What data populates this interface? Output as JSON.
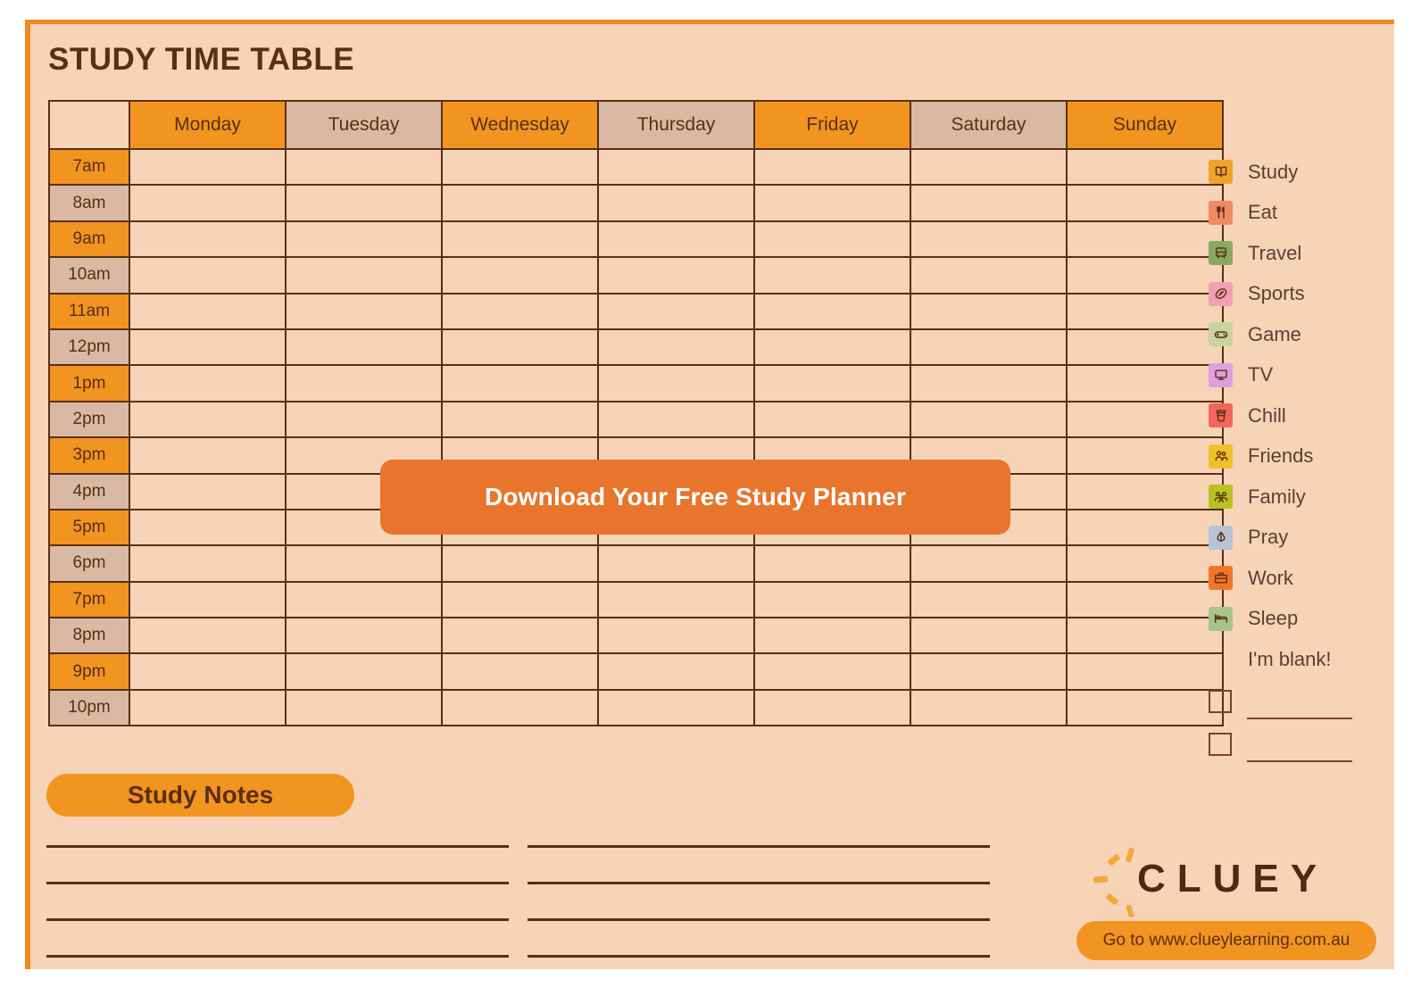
{
  "page": {
    "title": "STUDY TIME TABLE",
    "background_color": "#f7d3b7",
    "border_color": "#ef8a21",
    "text_color": "#5a2f12"
  },
  "timetable": {
    "corner_label": "",
    "days": [
      {
        "label": "Monday",
        "tint": "orange"
      },
      {
        "label": "Tuesday",
        "tint": "tan"
      },
      {
        "label": "Wednesday",
        "tint": "orange"
      },
      {
        "label": "Thursday",
        "tint": "tan"
      },
      {
        "label": "Friday",
        "tint": "orange"
      },
      {
        "label": "Saturday",
        "tint": "tan"
      },
      {
        "label": "Sunday",
        "tint": "orange"
      }
    ],
    "times": [
      {
        "label": "7am",
        "tint": "orange"
      },
      {
        "label": "8am",
        "tint": "tan"
      },
      {
        "label": "9am",
        "tint": "orange"
      },
      {
        "label": "10am",
        "tint": "tan"
      },
      {
        "label": "11am",
        "tint": "orange"
      },
      {
        "label": "12pm",
        "tint": "tan"
      },
      {
        "label": "1pm",
        "tint": "orange"
      },
      {
        "label": "2pm",
        "tint": "tan"
      },
      {
        "label": "3pm",
        "tint": "orange"
      },
      {
        "label": "4pm",
        "tint": "tan"
      },
      {
        "label": "5pm",
        "tint": "orange"
      },
      {
        "label": "6pm",
        "tint": "tan"
      },
      {
        "label": "7pm",
        "tint": "orange"
      },
      {
        "label": "8pm",
        "tint": "tan"
      },
      {
        "label": "9pm",
        "tint": "orange"
      },
      {
        "label": "10pm",
        "tint": "tan"
      }
    ],
    "cells": [],
    "colors": {
      "orange": "#f29420",
      "tan": "#d9b9a3",
      "slot": "#f7d3b7",
      "grid_line": "#5a2f12"
    }
  },
  "download_button": {
    "label": "Download Your Free Study Planner",
    "color": "#e8752b",
    "text_color": "#ffffff"
  },
  "legend": {
    "items": [
      {
        "label": "Study",
        "icon": "book-icon",
        "color": "#f0a32a"
      },
      {
        "label": "Eat",
        "icon": "cutlery-icon",
        "color": "#f08a62"
      },
      {
        "label": "Travel",
        "icon": "bus-icon",
        "color": "#8aa962"
      },
      {
        "label": "Sports",
        "icon": "football-icon",
        "color": "#f0a0b4"
      },
      {
        "label": "Game",
        "icon": "gamepad-icon",
        "color": "#c8d4a0"
      },
      {
        "label": "TV",
        "icon": "television-icon",
        "color": "#dda0dd"
      },
      {
        "label": "Chill",
        "icon": "coffee-cup-icon",
        "color": "#f0665c"
      },
      {
        "label": "Friends",
        "icon": "two-people-icon",
        "color": "#f0c02a"
      },
      {
        "label": "Family",
        "icon": "family-group-icon",
        "color": "#b5c221"
      },
      {
        "label": "Pray",
        "icon": "praying-hands-icon",
        "color": "#b8c2d4"
      },
      {
        "label": "Work",
        "icon": "briefcase-icon",
        "color": "#f0762a"
      },
      {
        "label": "Sleep",
        "icon": "bed-icon",
        "color": "#a8c48a"
      }
    ],
    "blank_label": "I'm blank!",
    "blank_rows": [
      {
        "value": ""
      },
      {
        "value": ""
      }
    ]
  },
  "study_notes": {
    "heading": "Study Notes",
    "left_lines": [
      "",
      "",
      "",
      ""
    ],
    "right_lines": [
      "",
      "",
      "",
      ""
    ]
  },
  "branding": {
    "wordmark": "CLUEY",
    "url_label": "Go to www.clueylearning.com.au"
  }
}
